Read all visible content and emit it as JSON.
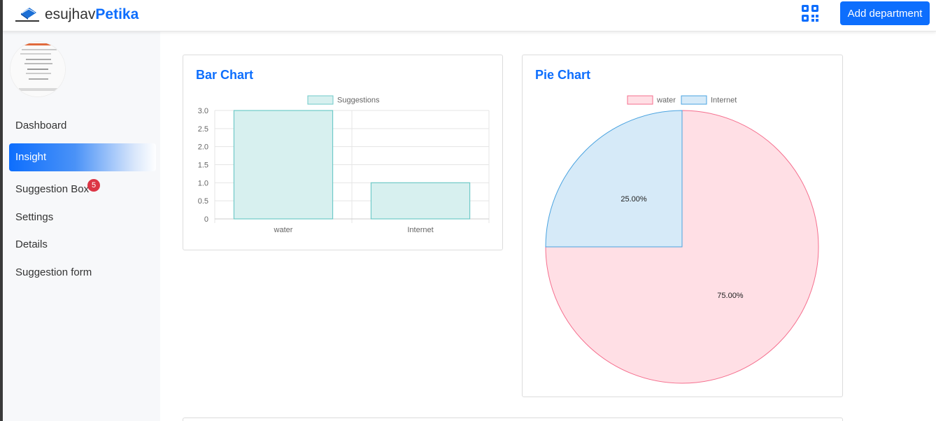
{
  "brand": {
    "name_part1": "esujhav",
    "name_part2": "Petika",
    "logo_icon": "envelope-logo-icon"
  },
  "header": {
    "qr_icon": "qr-code-icon",
    "add_department_label": "Add department"
  },
  "sidebar": {
    "items": [
      {
        "label": "Dashboard",
        "active": false
      },
      {
        "label": "Insight",
        "active": true
      },
      {
        "label": "Suggestion Box",
        "active": false,
        "badge": "5"
      },
      {
        "label": "Settings",
        "active": false
      },
      {
        "label": "Details",
        "active": false
      },
      {
        "label": "Suggestion form",
        "active": false
      }
    ]
  },
  "colors": {
    "accent": "#0d6efd",
    "bar_fill": "#d7f0ef",
    "bar_border": "#6fcac8",
    "pie_water_fill": "#ffdfe5",
    "pie_water_border": "#f56f8e",
    "pie_internet_fill": "#d6eaf8",
    "pie_internet_border": "#4aa3e0",
    "badge": "#dc3545"
  },
  "bar_card": {
    "title": "Bar Chart"
  },
  "pie_card": {
    "title": "Pie Chart"
  },
  "chart_data": [
    {
      "type": "bar",
      "title": "Bar Chart",
      "categories": [
        "water",
        "Internet"
      ],
      "series": [
        {
          "name": "Suggestions",
          "values": [
            3,
            1
          ]
        }
      ],
      "ylim": [
        0,
        3
      ],
      "yticks": [
        "3.0",
        "2.5",
        "2.0",
        "1.5",
        "1.0",
        "0.5",
        "0"
      ],
      "grid": true,
      "legend": "top"
    },
    {
      "type": "pie",
      "title": "Pie Chart",
      "labels": [
        "water",
        "Internet"
      ],
      "values": [
        3,
        1
      ],
      "data_labels": [
        "75.00%",
        "25.00%"
      ],
      "legend": "top"
    }
  ]
}
